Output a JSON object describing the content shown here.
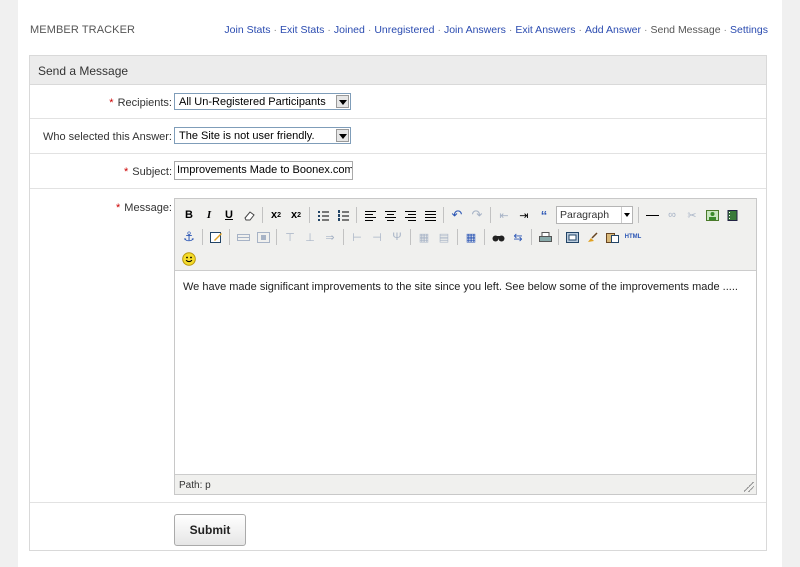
{
  "header": {
    "brand": "MEMBER TRACKER",
    "nav": [
      {
        "label": "Join Stats",
        "current": false
      },
      {
        "label": "Exit Stats",
        "current": false
      },
      {
        "label": "Joined",
        "current": false
      },
      {
        "label": "Unregistered",
        "current": false
      },
      {
        "label": "Join Answers",
        "current": false
      },
      {
        "label": "Exit Answers",
        "current": false
      },
      {
        "label": "Add Answer",
        "current": false
      },
      {
        "label": "Send Message",
        "current": true
      },
      {
        "label": "Settings",
        "current": false
      }
    ],
    "separator": "·"
  },
  "panel": {
    "title": "Send a Message"
  },
  "form": {
    "required_mark": "*",
    "recipients": {
      "label": "Recipients:",
      "value": "All Un-Registered Participants"
    },
    "answer": {
      "label": "Who selected this Answer:",
      "value": "The Site is not user friendly."
    },
    "subject": {
      "label": "Subject:",
      "value": "Improvements Made to Boonex.com"
    },
    "message": {
      "label": "Message:",
      "format": "Paragraph",
      "html_label": "HTML",
      "body": "We have made significant improvements to the site since you left. See below some of the improvements made .....",
      "path": "Path: p"
    },
    "submit_label": "Submit"
  },
  "colors": {
    "link": "#2a4bb0",
    "required": "#cc0000",
    "panel_header": "#ececec"
  }
}
